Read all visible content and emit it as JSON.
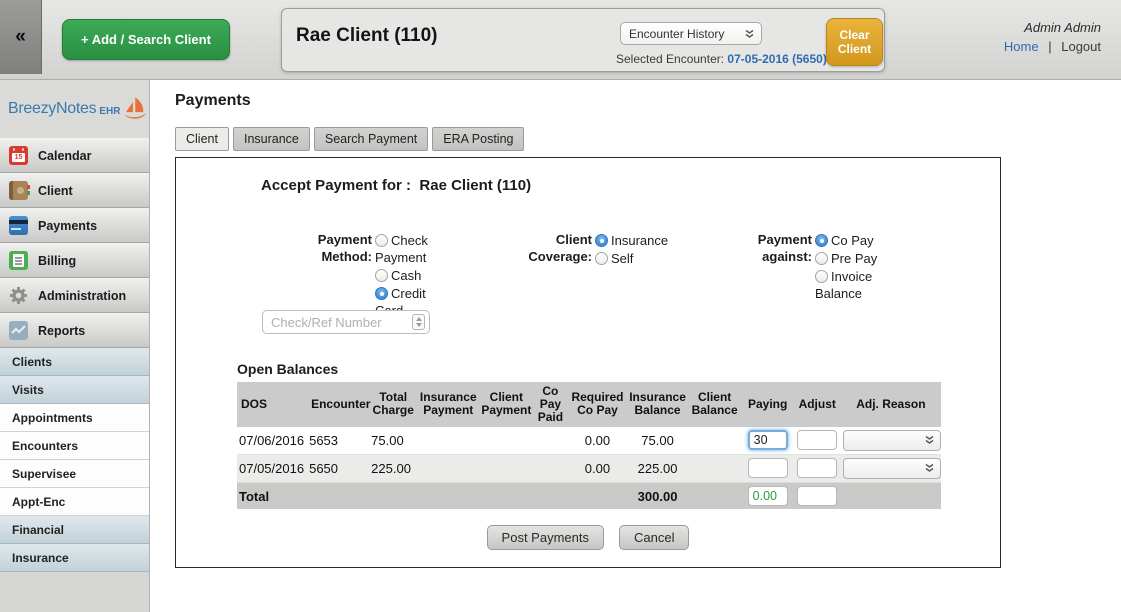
{
  "colors": {
    "accent_green": "#2f9e48",
    "accent_orange": "#dfa02c",
    "link_blue": "#2e6cb0",
    "radio_blue": "#3f8fdc",
    "total_green": "#2e9940",
    "logo_blue": "#3b7ab0",
    "logo_orange": "#e8713c"
  },
  "header": {
    "collapse_icon": "«",
    "add_search_button": "+ Add / Search Client",
    "client_name": "Rae Client (110)",
    "encounter_dropdown": "Encounter History",
    "selected_encounter_label": "Selected Encounter:",
    "selected_encounter_value": "07-05-2016 (5650)",
    "clear_client_button": "Clear Client",
    "user_name": "Admin Admin",
    "home_link": "Home",
    "link_separator": "|",
    "logout_link": "Logout"
  },
  "sidebar": {
    "logo_text": "BreezyNotes",
    "logo_suffix": "EHR",
    "menu": [
      {
        "label": "Calendar"
      },
      {
        "label": "Client"
      },
      {
        "label": "Payments"
      },
      {
        "label": "Billing"
      },
      {
        "label": "Administration"
      },
      {
        "label": "Reports"
      }
    ],
    "submenu": [
      {
        "label": "Clients",
        "highlighted": true
      },
      {
        "label": "Visits",
        "highlighted": true
      },
      {
        "label": "Appointments",
        "highlighted": false
      },
      {
        "label": "Encounters",
        "highlighted": false
      },
      {
        "label": "Supervisee",
        "highlighted": false
      },
      {
        "label": "Appt-Enc",
        "highlighted": false
      },
      {
        "label": "Financial",
        "highlighted": true
      },
      {
        "label": "Insurance",
        "highlighted": true
      }
    ]
  },
  "main": {
    "title": "Payments",
    "tabs": [
      {
        "label": "Client",
        "active": true
      },
      {
        "label": "Insurance",
        "active": false
      },
      {
        "label": "Search Payment",
        "active": false
      },
      {
        "label": "ERA Posting",
        "active": false
      }
    ],
    "form": {
      "heading_label": "Accept Payment for :",
      "heading_client": "Rae Client (110)",
      "payment_method": {
        "label": "Payment Method:",
        "options": [
          {
            "label": "Check Payment",
            "selected": false
          },
          {
            "label": "Cash",
            "selected": false
          },
          {
            "label": "Credit Card",
            "selected": true
          }
        ]
      },
      "client_coverage": {
        "label": "Client Coverage:",
        "options": [
          {
            "label": "Insurance",
            "selected": true
          },
          {
            "label": "Self",
            "selected": false
          }
        ]
      },
      "payment_against": {
        "label": "Payment against:",
        "options": [
          {
            "label": "Co Pay",
            "selected": true
          },
          {
            "label": "Pre Pay",
            "selected": false
          },
          {
            "label": "Invoice Balance",
            "selected": false
          }
        ]
      },
      "ref_input_placeholder": "Check/Ref Number"
    },
    "balances": {
      "heading": "Open Balances",
      "columns": [
        "DOS",
        "Encounter",
        "Total Charge",
        "Insurance Payment",
        "Client Payment",
        "Co Pay Paid",
        "Required Co Pay",
        "Insurance Balance",
        "Client Balance",
        "Paying",
        "Adjust",
        "Adj. Reason"
      ],
      "rows": [
        {
          "dos": "07/06/2016",
          "encounter": "5653",
          "total_charge": "75.00",
          "insurance_payment": "",
          "client_payment": "",
          "co_pay_paid": "",
          "required_co_pay": "0.00",
          "insurance_balance": "75.00",
          "client_balance": "",
          "paying": "30",
          "adjust": ""
        },
        {
          "dos": "07/05/2016",
          "encounter": "5650",
          "total_charge": "225.00",
          "insurance_payment": "",
          "client_payment": "",
          "co_pay_paid": "",
          "required_co_pay": "0.00",
          "insurance_balance": "225.00",
          "client_balance": "",
          "paying": "",
          "adjust": ""
        }
      ],
      "total_row": {
        "label": "Total",
        "insurance_balance": "300.00",
        "paying": "0.00",
        "adjust": ""
      }
    },
    "actions": {
      "post": "Post Payments",
      "cancel": "Cancel"
    }
  }
}
